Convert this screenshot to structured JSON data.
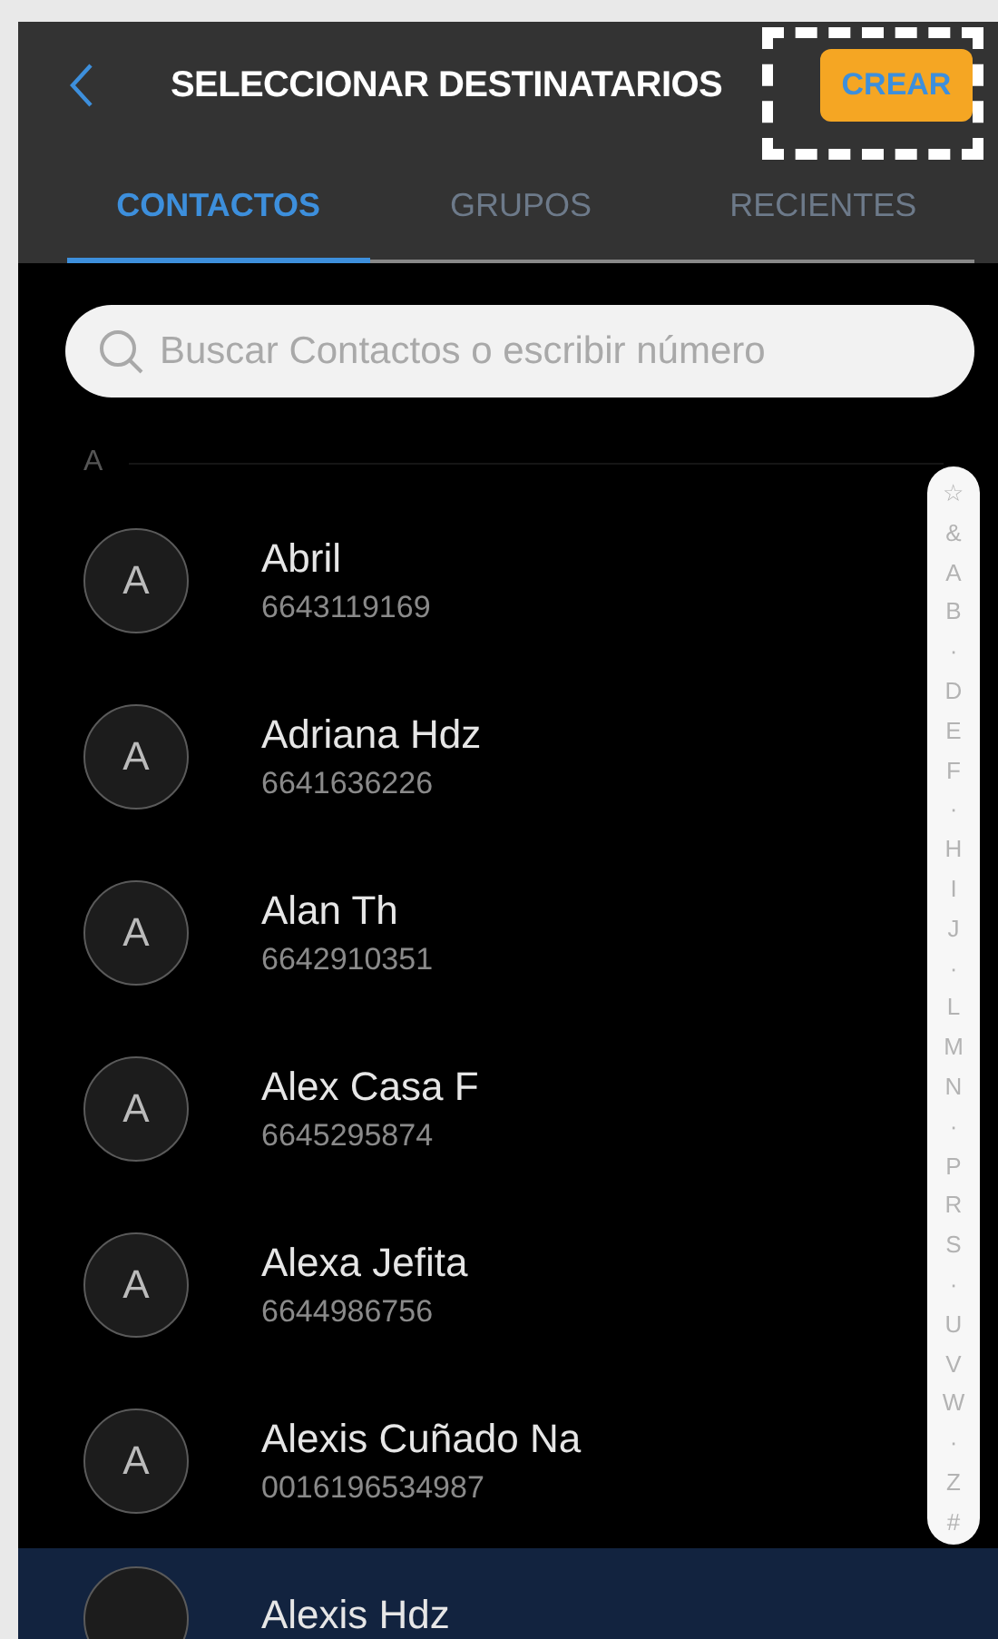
{
  "header": {
    "title": "SELECCIONAR DESTINATARIOS",
    "action": "CREAR",
    "action_highlighted": true
  },
  "tabs": [
    {
      "label": "CONTACTOS",
      "selected": true
    },
    {
      "label": "GRUPOS",
      "selected": false
    },
    {
      "label": "RECIENTES",
      "selected": false
    }
  ],
  "search": {
    "placeholder": "Buscar Contactos o escribir número"
  },
  "section": "A",
  "contacts": [
    {
      "initial": "A",
      "name": "Abril",
      "phone": "6643119169",
      "selected": false
    },
    {
      "initial": "A",
      "name": "Adriana Hdz",
      "phone": "6641636226",
      "selected": false
    },
    {
      "initial": "A",
      "name": "Alan Th",
      "phone": "6642910351",
      "selected": false
    },
    {
      "initial": "A",
      "name": "Alex Casa F",
      "phone": "6645295874",
      "selected": false
    },
    {
      "initial": "A",
      "name": "Alexa Jefita",
      "phone": "6644986756",
      "selected": false
    },
    {
      "initial": "A",
      "name": "Alexis Cuñado Na",
      "phone": "0016196534987",
      "selected": false
    },
    {
      "name": "Alexis Hdz",
      "selected": true
    }
  ],
  "index": [
    "☆",
    "&",
    "A",
    "B",
    "·",
    "D",
    "E",
    "F",
    "·",
    "H",
    "I",
    "J",
    "·",
    "L",
    "M",
    "N",
    "·",
    "P",
    "R",
    "S",
    "·",
    "U",
    "V",
    "W",
    "·",
    "Z",
    "#"
  ]
}
